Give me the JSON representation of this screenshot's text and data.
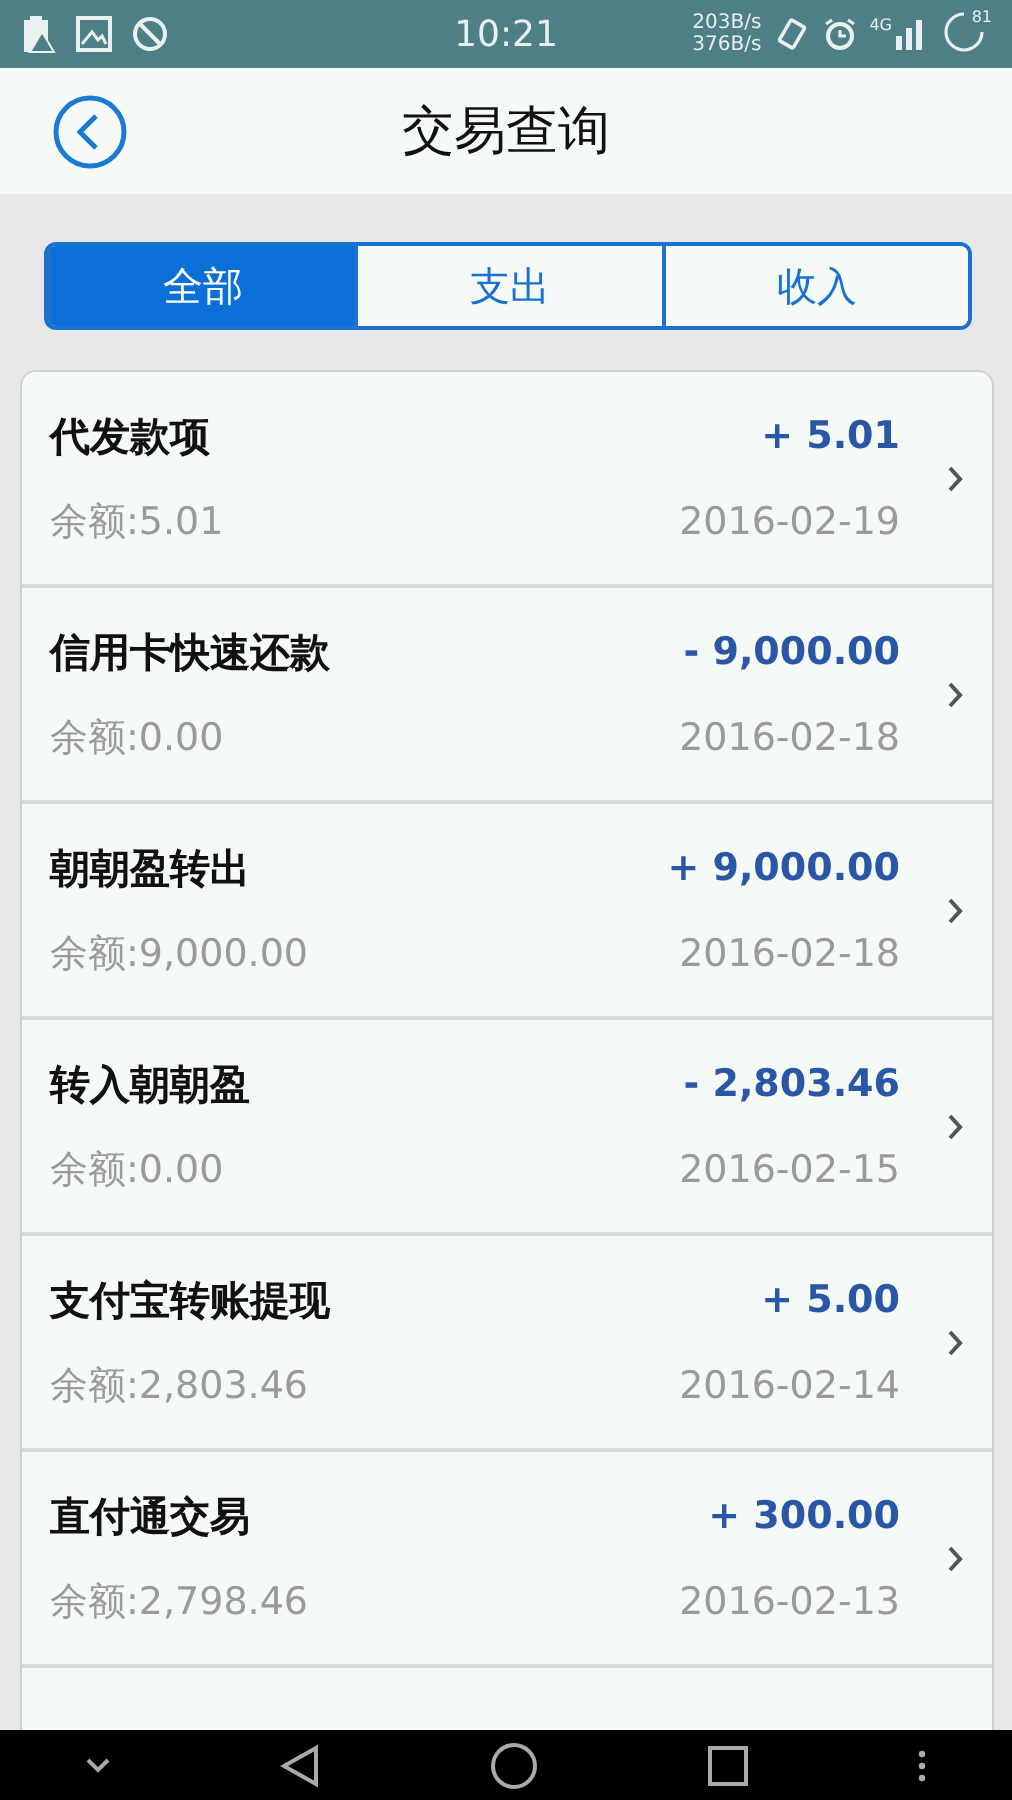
{
  "status_bar": {
    "time": "10:21",
    "net_up": "203B/s",
    "net_down": "376B/s",
    "network": "4G",
    "battery": "81"
  },
  "header": {
    "title": "交易查询"
  },
  "tabs": [
    {
      "label": "全部",
      "selected": true
    },
    {
      "label": "支出",
      "selected": false
    },
    {
      "label": "收入",
      "selected": false
    }
  ],
  "transactions": [
    {
      "name": "代发款项",
      "amount": "+ 5.01",
      "balance": "余额:5.01",
      "date": "2016-02-19"
    },
    {
      "name": "信用卡快速还款",
      "amount": "- 9,000.00",
      "balance": "余额:0.00",
      "date": "2016-02-18"
    },
    {
      "name": "朝朝盈转出",
      "amount": "+ 9,000.00",
      "balance": "余额:9,000.00",
      "date": "2016-02-18"
    },
    {
      "name": "转入朝朝盈",
      "amount": "- 2,803.46",
      "balance": "余额:0.00",
      "date": "2016-02-15"
    },
    {
      "name": "支付宝转账提现",
      "amount": "+ 5.00",
      "balance": "余额:2,803.46",
      "date": "2016-02-14"
    },
    {
      "name": "直付通交易",
      "amount": "+ 300.00",
      "balance": "余额:2,798.46",
      "date": "2016-02-13"
    }
  ]
}
